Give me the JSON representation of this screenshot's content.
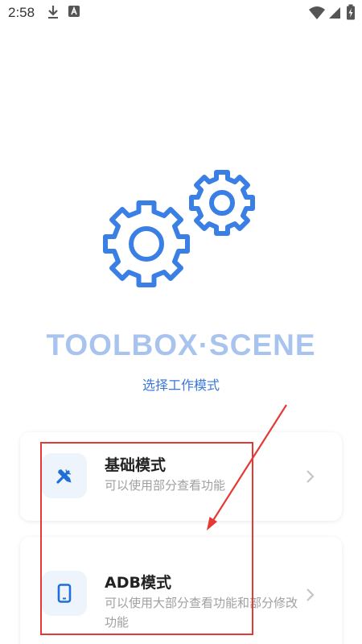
{
  "status_bar": {
    "time": "2:58",
    "icons": [
      "download-icon",
      "app-notification-icon",
      "wifi-icon",
      "signal-icon",
      "battery-icon"
    ]
  },
  "app": {
    "title": "TOOLBOX·SCENE",
    "subtitle": "选择工作模式",
    "logo_icon": "gears-icon"
  },
  "modes": [
    {
      "title": "基础模式",
      "description": "可以使用部分查看功能",
      "icon": "tools-icon"
    },
    {
      "title": "ADB模式",
      "description": "可以使用大部分查看功能和部分修改功能",
      "icon": "phone-icon"
    }
  ],
  "colors": {
    "accent": "#3a78d8",
    "title_light": "#a8c4ee",
    "annotation": "#e53935",
    "icon_bg": "#eef4fc"
  }
}
